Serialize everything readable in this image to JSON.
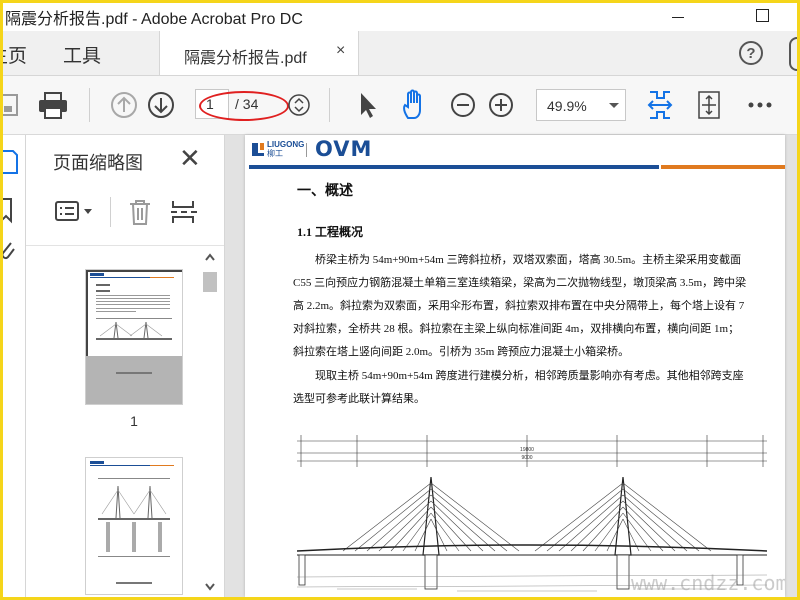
{
  "window": {
    "title": "隔震分析报告.pdf - Adobe Acrobat Pro DC"
  },
  "tabs": {
    "home_label": "主页",
    "tools_label": "工具",
    "document_label": "隔震分析报告.pdf",
    "close_symbol": "×",
    "help_symbol": "?"
  },
  "toolbar": {
    "current_page": "1",
    "total_pages": "/ 34",
    "zoom": "49.9%"
  },
  "panel": {
    "title": "页面缩略图",
    "close_symbol": "✕",
    "thumbnails": [
      {
        "label": "1"
      }
    ]
  },
  "document": {
    "logo_brand": "LIUGONG",
    "logo_brand_cn": "柳工",
    "logo_ovm": "OVM",
    "heading1": "一、概述",
    "heading2": "1.1  工程概况",
    "para_lines": [
      "桥梁主桥为 54m+90m+54m 三跨斜拉桥，双塔双索面，塔高 30.5m。主桥主梁采用变截面",
      "C55 三向预应力钢筋混凝土单箱三室连续箱梁，梁高为二次抛物线型，墩顶梁高 3.5m，跨中梁",
      "高 2.2m。斜拉索为双索面，采用伞形布置，斜拉索双排布置在中央分隔带上，每个塔上设有 7",
      "对斜拉索，全桥共 28 根。斜拉索在主梁上纵向标准间距 4m，双排横向布置，横向间距 1m；",
      "斜拉索在塔上竖向间距 2.0m。引桥为 35m 跨预应力混凝土小箱梁桥。"
    ],
    "para2_lines": [
      "现取主桥 54m+90m+54m 跨度进行建模分析，相邻跨质量影响亦有考虑。其他相邻跨支座",
      "选型可参考此联计算结果。"
    ],
    "drawing_dim_top": "19800",
    "drawing_dim_mid": "9000",
    "watermark": "www.cndzz.com"
  },
  "colors": {
    "frame_border": "#f5d51a",
    "accent_blue": "#1473e6",
    "annotation_red": "#e02020",
    "logo_blue": "#1b4e96",
    "logo_orange": "#e07a1f"
  }
}
